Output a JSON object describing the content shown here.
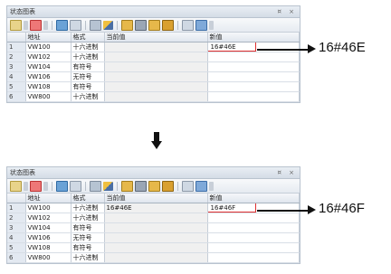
{
  "panels": {
    "top": {
      "title": "状态图表",
      "window_controls": "¤ ×",
      "columns": [
        "",
        "地址",
        "格式",
        "当前值",
        "新值"
      ],
      "rows": [
        {
          "num": "1",
          "address": "VW100",
          "format": "十六进制",
          "current": "",
          "new": "16#46E"
        },
        {
          "num": "2",
          "address": "VW102",
          "format": "十六进制",
          "current": "",
          "new": ""
        },
        {
          "num": "3",
          "address": "VW104",
          "format": "有符号",
          "current": "",
          "new": ""
        },
        {
          "num": "4",
          "address": "VW106",
          "format": "无符号",
          "current": "",
          "new": ""
        },
        {
          "num": "5",
          "address": "VW108",
          "format": "有符号",
          "current": "",
          "new": ""
        },
        {
          "num": "6",
          "address": "VW800",
          "format": "十六进制",
          "current": "",
          "new": ""
        }
      ],
      "callout": "16#46E"
    },
    "bottom": {
      "title": "状态图表",
      "window_controls": "¤ ×",
      "columns": [
        "",
        "地址",
        "格式",
        "当前值",
        "新值"
      ],
      "rows": [
        {
          "num": "1",
          "address": "VW100",
          "format": "十六进制",
          "current": "16#46E",
          "new": "16#46F"
        },
        {
          "num": "2",
          "address": "VW102",
          "format": "十六进制",
          "current": "",
          "new": ""
        },
        {
          "num": "3",
          "address": "VW104",
          "format": "有符号",
          "current": "",
          "new": ""
        },
        {
          "num": "4",
          "address": "VW106",
          "format": "无符号",
          "current": "",
          "new": ""
        },
        {
          "num": "5",
          "address": "VW108",
          "format": "有符号",
          "current": "",
          "new": ""
        },
        {
          "num": "6",
          "address": "VW800",
          "format": "十六进制",
          "current": "",
          "new": ""
        }
      ],
      "callout": "16#46F"
    }
  },
  "toolbar_icons": [
    "add-icon",
    "dropdown-icon",
    "delete-icon",
    "dropdown-icon",
    "table-icon",
    "sheet-icon",
    "chart-icon",
    "pencil-icon",
    "lock-icon",
    "read-icon",
    "write-icon",
    "force-icon",
    "trend-icon",
    "view-icon",
    "dropdown-icon"
  ],
  "colors": {
    "highlight_border": "#e03030",
    "accent": "#2b6cb0"
  }
}
